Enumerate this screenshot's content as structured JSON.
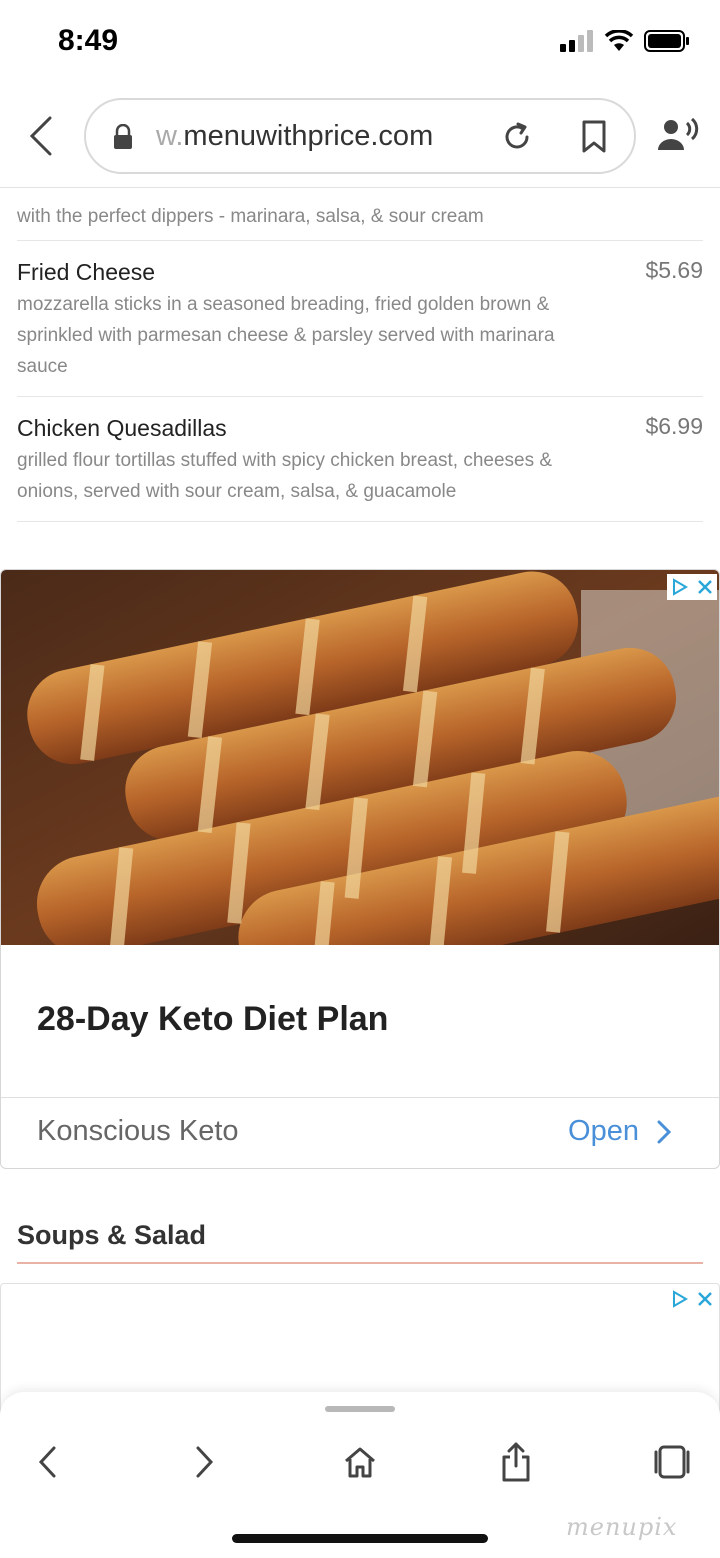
{
  "status_bar": {
    "time": "8:49"
  },
  "browser": {
    "url_faded": "w.",
    "url_main": "menuwithprice.com"
  },
  "menu": {
    "partial_item_desc": "with the perfect dippers - marinara, salsa, & sour cream",
    "items": [
      {
        "name": "Fried Cheese",
        "price": "$5.69",
        "description": "mozzarella sticks in a seasoned breading, fried golden brown & sprinkled with parmesan cheese & parsley served with marinara sauce"
      },
      {
        "name": "Chicken Quesadillas",
        "price": "$6.99",
        "description": "grilled flour tortillas stuffed with spicy chicken breast, cheeses & onions, served with sour cream, salsa, & guacamole"
      }
    ]
  },
  "ad": {
    "title": "28-Day Keto Diet Plan",
    "brand": "Konscious Keto",
    "cta": "Open"
  },
  "section": {
    "title": "Soups & Salad"
  },
  "watermark": "menupix",
  "colors": {
    "accent_blue": "#4a90d9",
    "section_rule": "#e8b3a5"
  }
}
